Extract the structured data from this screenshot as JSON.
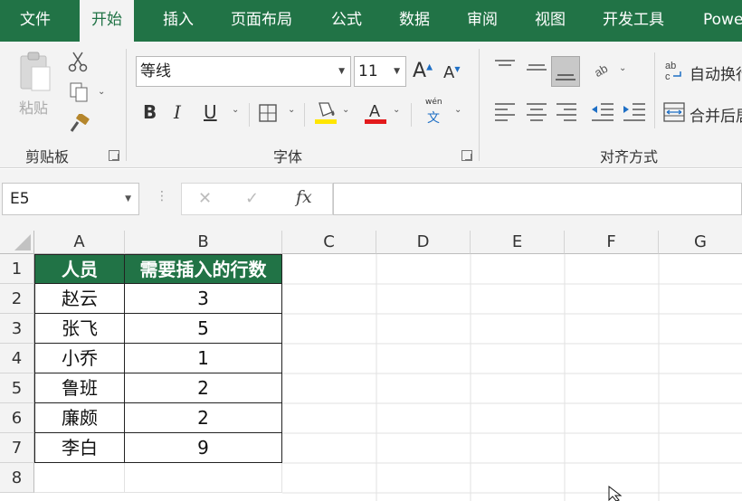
{
  "tabs": [
    "文件",
    "开始",
    "插入",
    "页面布局",
    "公式",
    "数据",
    "审阅",
    "视图",
    "开发工具",
    "Powe"
  ],
  "active_tab": "开始",
  "ribbon": {
    "clipboard": {
      "paste_label": "粘贴",
      "group_label": "剪贴板"
    },
    "font": {
      "font_name": "等线",
      "font_size": "11",
      "bold": "B",
      "italic": "I",
      "underline": "U",
      "phonetic_top": "wén",
      "phonetic_bottom": "文",
      "group_label": "字体"
    },
    "alignment": {
      "wrap_text": "自动换行",
      "merge_center": "合并后居",
      "group_label": "对齐方式"
    }
  },
  "formula_bar": {
    "name_box": "E5",
    "formula": ""
  },
  "columns": [
    "A",
    "B",
    "C",
    "D",
    "E",
    "F",
    "G"
  ],
  "rows": [
    "1",
    "2",
    "3",
    "4",
    "5",
    "6",
    "7",
    "8"
  ],
  "table": {
    "headers": [
      "人员",
      "需要插入的行数"
    ],
    "rows": [
      [
        "赵云",
        "3"
      ],
      [
        "张飞",
        "5"
      ],
      [
        "小乔",
        "1"
      ],
      [
        "鲁班",
        "2"
      ],
      [
        "廉颇",
        "2"
      ],
      [
        "李白",
        "9"
      ]
    ]
  },
  "colors": {
    "accent": "#217346",
    "ribbon_bg": "#f3f3f3",
    "font_color_bar": "#e3191b",
    "fill_color_bar": "#ffe600"
  }
}
